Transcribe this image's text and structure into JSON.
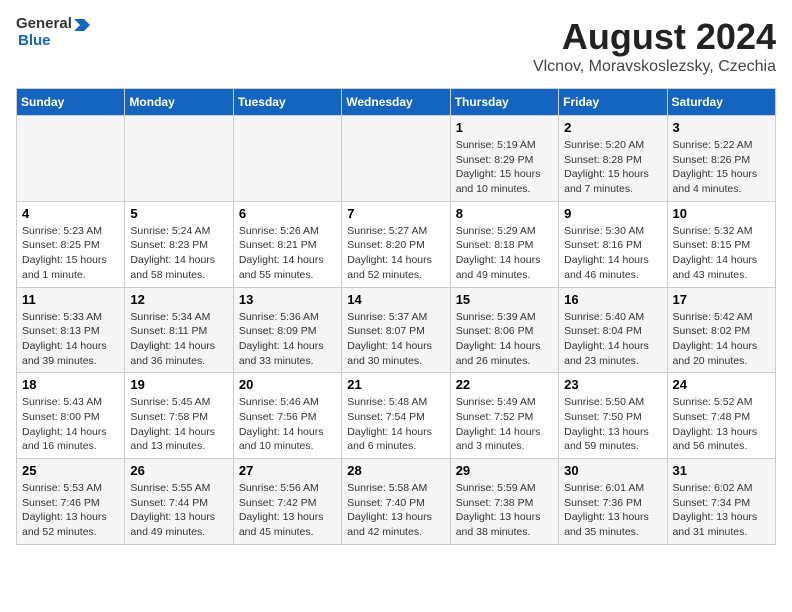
{
  "logo": {
    "text_general": "General",
    "text_blue": "Blue"
  },
  "title": "August 2024",
  "subtitle": "Vlcnov, Moravskoslezsky, Czechia",
  "days_of_week": [
    "Sunday",
    "Monday",
    "Tuesday",
    "Wednesday",
    "Thursday",
    "Friday",
    "Saturday"
  ],
  "weeks": [
    [
      {
        "day": "",
        "info": ""
      },
      {
        "day": "",
        "info": ""
      },
      {
        "day": "",
        "info": ""
      },
      {
        "day": "",
        "info": ""
      },
      {
        "day": "1",
        "info": "Sunrise: 5:19 AM\nSunset: 8:29 PM\nDaylight: 15 hours\nand 10 minutes."
      },
      {
        "day": "2",
        "info": "Sunrise: 5:20 AM\nSunset: 8:28 PM\nDaylight: 15 hours\nand 7 minutes."
      },
      {
        "day": "3",
        "info": "Sunrise: 5:22 AM\nSunset: 8:26 PM\nDaylight: 15 hours\nand 4 minutes."
      }
    ],
    [
      {
        "day": "4",
        "info": "Sunrise: 5:23 AM\nSunset: 8:25 PM\nDaylight: 15 hours\nand 1 minute."
      },
      {
        "day": "5",
        "info": "Sunrise: 5:24 AM\nSunset: 8:23 PM\nDaylight: 14 hours\nand 58 minutes."
      },
      {
        "day": "6",
        "info": "Sunrise: 5:26 AM\nSunset: 8:21 PM\nDaylight: 14 hours\nand 55 minutes."
      },
      {
        "day": "7",
        "info": "Sunrise: 5:27 AM\nSunset: 8:20 PM\nDaylight: 14 hours\nand 52 minutes."
      },
      {
        "day": "8",
        "info": "Sunrise: 5:29 AM\nSunset: 8:18 PM\nDaylight: 14 hours\nand 49 minutes."
      },
      {
        "day": "9",
        "info": "Sunrise: 5:30 AM\nSunset: 8:16 PM\nDaylight: 14 hours\nand 46 minutes."
      },
      {
        "day": "10",
        "info": "Sunrise: 5:32 AM\nSunset: 8:15 PM\nDaylight: 14 hours\nand 43 minutes."
      }
    ],
    [
      {
        "day": "11",
        "info": "Sunrise: 5:33 AM\nSunset: 8:13 PM\nDaylight: 14 hours\nand 39 minutes."
      },
      {
        "day": "12",
        "info": "Sunrise: 5:34 AM\nSunset: 8:11 PM\nDaylight: 14 hours\nand 36 minutes."
      },
      {
        "day": "13",
        "info": "Sunrise: 5:36 AM\nSunset: 8:09 PM\nDaylight: 14 hours\nand 33 minutes."
      },
      {
        "day": "14",
        "info": "Sunrise: 5:37 AM\nSunset: 8:07 PM\nDaylight: 14 hours\nand 30 minutes."
      },
      {
        "day": "15",
        "info": "Sunrise: 5:39 AM\nSunset: 8:06 PM\nDaylight: 14 hours\nand 26 minutes."
      },
      {
        "day": "16",
        "info": "Sunrise: 5:40 AM\nSunset: 8:04 PM\nDaylight: 14 hours\nand 23 minutes."
      },
      {
        "day": "17",
        "info": "Sunrise: 5:42 AM\nSunset: 8:02 PM\nDaylight: 14 hours\nand 20 minutes."
      }
    ],
    [
      {
        "day": "18",
        "info": "Sunrise: 5:43 AM\nSunset: 8:00 PM\nDaylight: 14 hours\nand 16 minutes."
      },
      {
        "day": "19",
        "info": "Sunrise: 5:45 AM\nSunset: 7:58 PM\nDaylight: 14 hours\nand 13 minutes."
      },
      {
        "day": "20",
        "info": "Sunrise: 5:46 AM\nSunset: 7:56 PM\nDaylight: 14 hours\nand 10 minutes."
      },
      {
        "day": "21",
        "info": "Sunrise: 5:48 AM\nSunset: 7:54 PM\nDaylight: 14 hours\nand 6 minutes."
      },
      {
        "day": "22",
        "info": "Sunrise: 5:49 AM\nSunset: 7:52 PM\nDaylight: 14 hours\nand 3 minutes."
      },
      {
        "day": "23",
        "info": "Sunrise: 5:50 AM\nSunset: 7:50 PM\nDaylight: 13 hours\nand 59 minutes."
      },
      {
        "day": "24",
        "info": "Sunrise: 5:52 AM\nSunset: 7:48 PM\nDaylight: 13 hours\nand 56 minutes."
      }
    ],
    [
      {
        "day": "25",
        "info": "Sunrise: 5:53 AM\nSunset: 7:46 PM\nDaylight: 13 hours\nand 52 minutes."
      },
      {
        "day": "26",
        "info": "Sunrise: 5:55 AM\nSunset: 7:44 PM\nDaylight: 13 hours\nand 49 minutes."
      },
      {
        "day": "27",
        "info": "Sunrise: 5:56 AM\nSunset: 7:42 PM\nDaylight: 13 hours\nand 45 minutes."
      },
      {
        "day": "28",
        "info": "Sunrise: 5:58 AM\nSunset: 7:40 PM\nDaylight: 13 hours\nand 42 minutes."
      },
      {
        "day": "29",
        "info": "Sunrise: 5:59 AM\nSunset: 7:38 PM\nDaylight: 13 hours\nand 38 minutes."
      },
      {
        "day": "30",
        "info": "Sunrise: 6:01 AM\nSunset: 7:36 PM\nDaylight: 13 hours\nand 35 minutes."
      },
      {
        "day": "31",
        "info": "Sunrise: 6:02 AM\nSunset: 7:34 PM\nDaylight: 13 hours\nand 31 minutes."
      }
    ]
  ]
}
